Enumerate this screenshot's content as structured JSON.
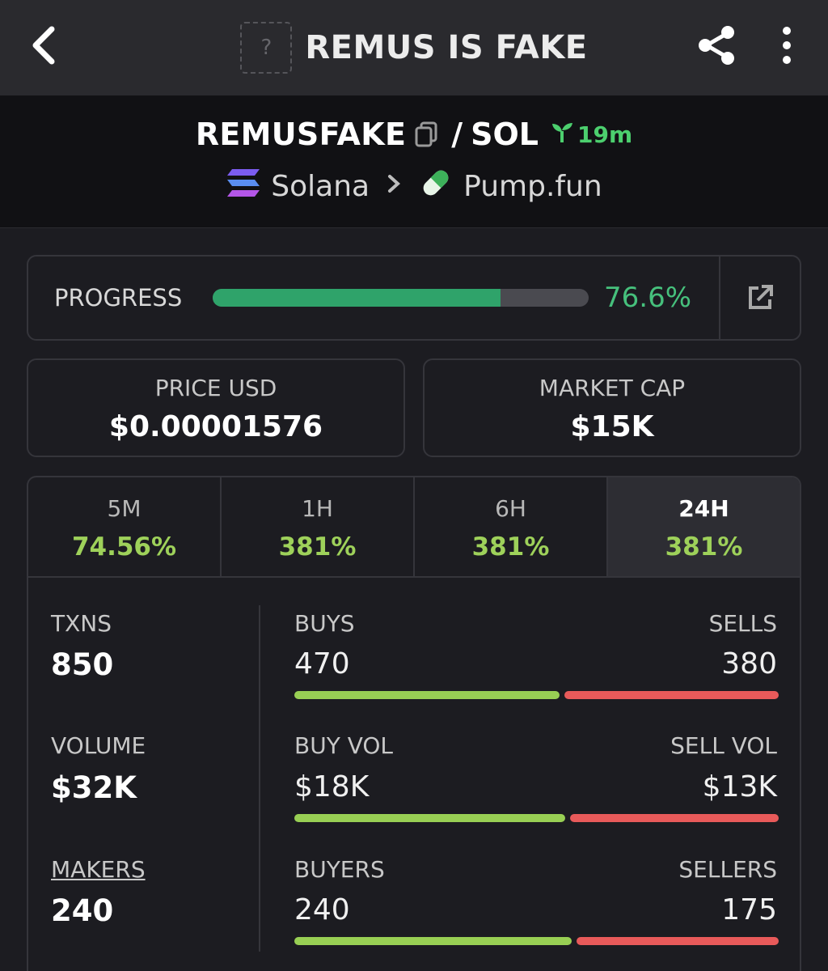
{
  "header": {
    "title": "REMUS IS FAKE",
    "token_image_placeholder": "?",
    "icons": {
      "back": "back-arrow-icon",
      "share": "share-icon",
      "more": "more-vertical-icon"
    }
  },
  "pair": {
    "base": "REMUSFAKE",
    "quote": "SOL",
    "age": "19m",
    "chain": "Solana",
    "dex": "Pump.fun"
  },
  "progress": {
    "label": "PROGRESS",
    "value": "76.6%",
    "fraction": 0.766
  },
  "price": {
    "label": "PRICE USD",
    "value": "$0.00001576"
  },
  "market_cap": {
    "label": "MARKET CAP",
    "value": "$15K"
  },
  "tabs": [
    {
      "label": "5M",
      "value": "74.56%"
    },
    {
      "label": "1H",
      "value": "381%"
    },
    {
      "label": "6H",
      "value": "381%"
    },
    {
      "label": "24H",
      "value": "381%",
      "active": true
    }
  ],
  "txns": {
    "label": "TXNS",
    "value": "850",
    "buys_label": "BUYS",
    "buys": "470",
    "sells_label": "SELLS",
    "sells": "380",
    "buy_fraction": 0.553
  },
  "volume": {
    "label": "VOLUME",
    "value": "$32K",
    "buy_label": "BUY VOL",
    "buy": "$18K",
    "sell_label": "SELL VOL",
    "sell": "$13K",
    "buy_fraction": 0.565
  },
  "makers": {
    "label": "MAKERS",
    "value": "240",
    "buyers_label": "BUYERS",
    "buyers": "240",
    "sellers_label": "SELLERS",
    "sellers": "175",
    "buy_fraction": 0.578
  },
  "colors": {
    "green_bar": "#2fa36a",
    "buy": "#98cf54",
    "sell": "#e85a5a",
    "age": "#4ccf6e"
  }
}
